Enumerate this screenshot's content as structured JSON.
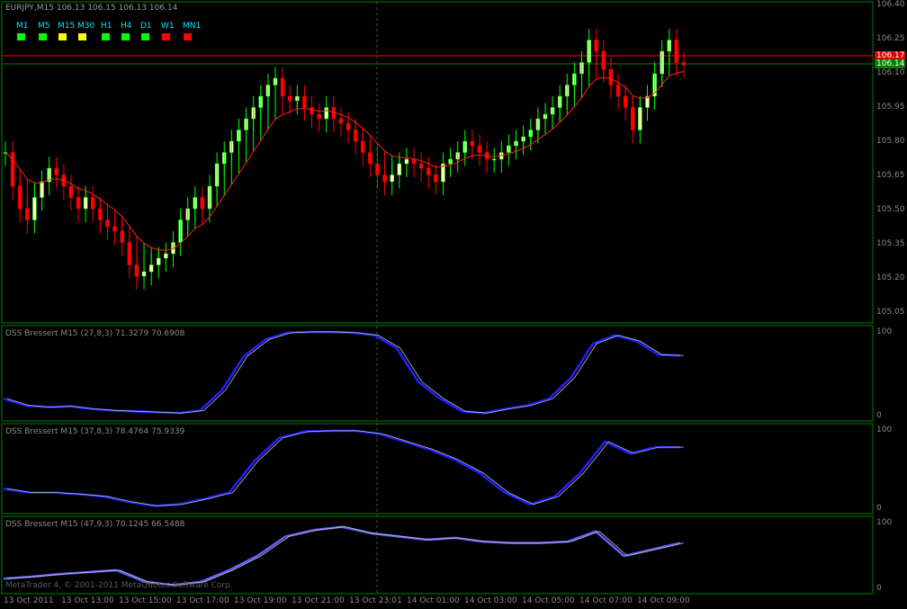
{
  "header": {
    "symbol_info": "EURJPY,M15  106.13 106.15 106.13 106.14"
  },
  "timeframes": [
    {
      "label": "M1",
      "color": "#00ff00"
    },
    {
      "label": "M5",
      "color": "#00ff00"
    },
    {
      "label": "M15",
      "color": "#ffff00"
    },
    {
      "label": "M30",
      "color": "#ffff00"
    },
    {
      "label": "H1",
      "color": "#00ff00"
    },
    {
      "label": "H4",
      "color": "#00ff00"
    },
    {
      "label": "D1",
      "color": "#00ff00"
    },
    {
      "label": "W1",
      "color": "#ff0000"
    },
    {
      "label": "MN1",
      "color": "#ff0000"
    }
  ],
  "price_axis": {
    "ticks": [
      "106.40",
      "106.25",
      "106.10",
      "105.95",
      "105.80",
      "105.65",
      "105.50",
      "105.35",
      "105.20",
      "105.05"
    ],
    "ask_label": "106.17",
    "bid_label": "106.14"
  },
  "indicators": [
    {
      "label": "DSS Bressert M15 (27,8,3) 71.3279 70.6908",
      "max": "100",
      "min": "0"
    },
    {
      "label": "DSS Bressert M15 (37,8,3) 78.4764 75.9339",
      "max": "100",
      "min": "0"
    },
    {
      "label": "DSS Bressert M15 (47,9,3) 70.1245 66.5488",
      "max": "100",
      "min": "0"
    }
  ],
  "time_axis": [
    "13 Oct 2011",
    "13 Oct 13:00",
    "13 Oct 15:00",
    "13 Oct 17:00",
    "13 Oct 19:00",
    "13 Oct 21:00",
    "13 Oct 23:01",
    "14 Oct 01:00",
    "14 Oct 03:00",
    "14 Oct 05:00",
    "14 Oct 07:00",
    "14 Oct 09:00"
  ],
  "copyright": "MetaTrader 4, © 2001-2011 MetaQuotes Software Corp.",
  "colors": {
    "frame": "#008000",
    "bull_candle": "#00ff00",
    "bull_body": "#ffffc0",
    "bear_candle": "#ff0000",
    "ma_line": "#ff2020",
    "dss_main": "#2020ff",
    "dss_signal": "#c0c0c0"
  },
  "chart_data": {
    "type": "candlestick",
    "symbol": "EURJPY",
    "timeframe": "M15",
    "ylim": [
      105.0,
      106.42
    ],
    "last_close": 106.14,
    "ask": 106.17,
    "closes": [
      105.75,
      105.6,
      105.5,
      105.45,
      105.55,
      105.62,
      105.68,
      105.65,
      105.6,
      105.55,
      105.5,
      105.55,
      105.5,
      105.45,
      105.42,
      105.4,
      105.35,
      105.25,
      105.2,
      105.22,
      105.25,
      105.28,
      105.3,
      105.35,
      105.45,
      105.5,
      105.55,
      105.5,
      105.6,
      105.7,
      105.75,
      105.8,
      105.85,
      105.9,
      105.95,
      106.0,
      106.05,
      106.08,
      106.0,
      105.98,
      106.0,
      105.95,
      105.92,
      105.9,
      105.95,
      105.9,
      105.88,
      105.85,
      105.8,
      105.75,
      105.7,
      105.65,
      105.62,
      105.65,
      105.7,
      105.72,
      105.7,
      105.68,
      105.65,
      105.62,
      105.7,
      105.72,
      105.75,
      105.8,
      105.78,
      105.75,
      105.72,
      105.72,
      105.75,
      105.78,
      105.8,
      105.82,
      105.85,
      105.9,
      105.92,
      105.95,
      106.0,
      106.05,
      106.1,
      106.15,
      106.25,
      106.2,
      106.12,
      106.05,
      106.0,
      105.95,
      105.85,
      105.95,
      106.0,
      106.1,
      106.2,
      106.25,
      106.15,
      106.14
    ],
    "dss": [
      {
        "name": "DSS Bressert M15 (27,8,3)",
        "values": [
          71.3279,
          70.6908
        ]
      },
      {
        "name": "DSS Bressert M15 (37,8,3)",
        "values": [
          78.4764,
          75.9339
        ]
      },
      {
        "name": "DSS Bressert M15 (47,9,3)",
        "values": [
          70.1245,
          66.5488
        ]
      }
    ],
    "dss_paths": [
      [
        20,
        12,
        10,
        11,
        8,
        6,
        5,
        4,
        3,
        6,
        30,
        70,
        90,
        98,
        99,
        99,
        98,
        95,
        80,
        40,
        20,
        5,
        3,
        8,
        12,
        20,
        45,
        85,
        95,
        88,
        72,
        71
      ],
      [
        25,
        20,
        20,
        18,
        15,
        8,
        3,
        5,
        12,
        20,
        60,
        90,
        98,
        99,
        99,
        95,
        85,
        75,
        62,
        45,
        20,
        5,
        15,
        45,
        85,
        70,
        78,
        78
      ],
      [
        15,
        18,
        22,
        25,
        28,
        10,
        5,
        10,
        28,
        50,
        80,
        90,
        95,
        85,
        80,
        75,
        78,
        72,
        70,
        70,
        72,
        88,
        50,
        60,
        70
      ]
    ]
  }
}
